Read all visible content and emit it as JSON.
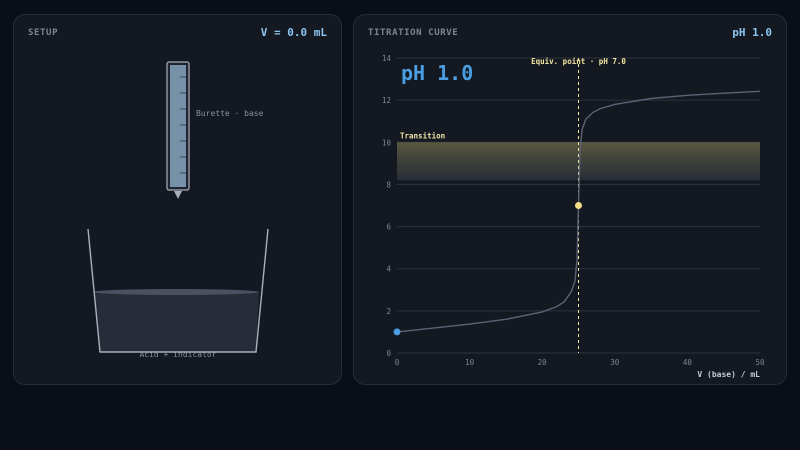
{
  "setup": {
    "title": "SETUP",
    "volume_readout": "V = 0.0 mL",
    "burette_label": "Burette · base",
    "beaker_label": "Acid + indicator"
  },
  "curve": {
    "title": "TITRATION CURVE",
    "ph_readout": "pH 1.0",
    "big_ph": "pH 1.0",
    "equiv_label": "Equiv. point · pH 7.0",
    "transition_label": "Transition"
  },
  "chart_data": {
    "type": "line",
    "title": "",
    "xlabel": "V (base) / mL",
    "ylabel": "",
    "xlim": [
      0,
      50
    ],
    "ylim": [
      0,
      14
    ],
    "x_ticks": [
      0,
      10,
      20,
      30,
      40,
      50
    ],
    "y_ticks": [
      0,
      2,
      4,
      6,
      8,
      10,
      12,
      14
    ],
    "grid": true,
    "transition_range": [
      8.2,
      10
    ],
    "equivalence_point": {
      "x": 25,
      "y": 7.0
    },
    "current_point": {
      "x": 0,
      "y": 1.0
    },
    "series": [
      {
        "x": [
          0,
          5,
          10,
          15,
          20,
          22,
          23,
          24,
          24.5,
          24.8,
          25,
          25.2,
          25.5,
          26,
          27,
          28,
          30,
          35,
          40,
          45,
          50
        ],
        "y": [
          1.0,
          1.18,
          1.37,
          1.6,
          1.95,
          2.2,
          2.42,
          2.9,
          3.4,
          4.4,
          7.0,
          9.6,
          10.6,
          11.1,
          11.42,
          11.6,
          11.8,
          12.08,
          12.23,
          12.33,
          12.42
        ]
      }
    ],
    "colors": {
      "curve": "#5c6374",
      "equivalence": "#f3e6a0",
      "current": "#4a9de0",
      "transition_band": "#6b6a45"
    }
  }
}
